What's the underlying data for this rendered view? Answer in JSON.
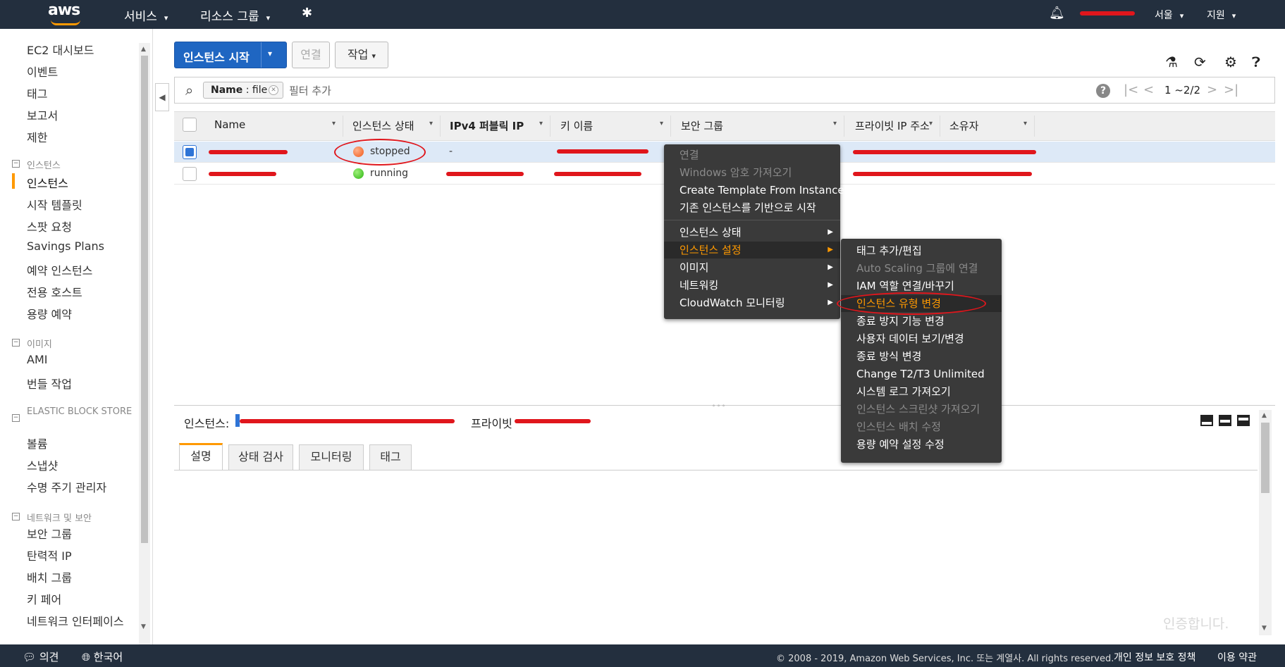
{
  "topbar": {
    "logo_text": "aws",
    "services": "서비스",
    "resource_groups": "리소스 그룹",
    "pin_icon": "pin-icon",
    "bell_icon": "bell-icon",
    "region": "서울",
    "support": "지원",
    "caret": "▾"
  },
  "sidebar": {
    "top_items": [
      "EC2 대시보드",
      "이벤트",
      "태그",
      "보고서",
      "제한"
    ],
    "sections": [
      {
        "title": "인스턴스",
        "items": [
          "인스턴스",
          "시작 템플릿",
          "스팟 요청",
          "Savings Plans",
          "예약 인스턴스",
          "전용 호스트",
          "용량 예약"
        ]
      },
      {
        "title": "이미지",
        "items": [
          "AMI",
          "번들 작업"
        ]
      },
      {
        "title": "ELASTIC BLOCK STORE",
        "items": [
          "볼륨",
          "스냅샷",
          "수명 주기 관리자"
        ]
      },
      {
        "title": "네트워크 및 보안",
        "items": [
          "보안 그룹",
          "탄력적 IP",
          "배치 그룹",
          "키 페어",
          "네트워크 인터페이스"
        ]
      }
    ],
    "active_item": "인스턴스"
  },
  "toolbar": {
    "launch": "인스턴스 시작",
    "connect": "연결",
    "actions": "작업"
  },
  "filter": {
    "chip_key": "Name",
    "chip_value": ": file",
    "placeholder": "필터 추가",
    "pagination": "1 ~2/2"
  },
  "table": {
    "columns": [
      "Name",
      "인스턴스 상태",
      "IPv4 퍼블릭 IP",
      "키 이름",
      "보안 그룹",
      "프라이빗 IP 주소",
      "소유자"
    ],
    "rows": [
      {
        "status": "stopped",
        "ipv4": "-",
        "selected": true
      },
      {
        "status": "running",
        "ipv4": "",
        "selected": false
      }
    ]
  },
  "detail": {
    "instance_label": "인스턴스:",
    "private_label": "프라이빗",
    "tabs": [
      "설명",
      "상태 검사",
      "모니터링",
      "태그"
    ]
  },
  "context_menu": {
    "group1": [
      {
        "label": "연결",
        "disabled": true
      },
      {
        "label": "Windows 암호 가져오기",
        "disabled": true
      },
      {
        "label": "Create Template From Instance",
        "disabled": false
      },
      {
        "label": "기존 인스턴스를 기반으로 시작",
        "disabled": false
      }
    ],
    "group2": [
      {
        "label": "인스턴스 상태",
        "highlight": false
      },
      {
        "label": "인스턴스 설정",
        "highlight": true
      },
      {
        "label": "이미지",
        "highlight": false
      },
      {
        "label": "네트워킹",
        "highlight": false
      },
      {
        "label": "CloudWatch 모니터링",
        "highlight": false
      }
    ]
  },
  "submenu": [
    {
      "label": "태그 추가/편집",
      "disabled": false
    },
    {
      "label": "Auto Scaling 그룹에 연결",
      "disabled": true
    },
    {
      "label": "IAM 역할 연결/바꾸기",
      "disabled": false
    },
    {
      "label": "인스턴스 유형 변경",
      "disabled": false,
      "highlight": true
    },
    {
      "label": "종료 방지 기능 변경",
      "disabled": false
    },
    {
      "label": "사용자 데이터 보기/변경",
      "disabled": false
    },
    {
      "label": "종료 방식 변경",
      "disabled": false
    },
    {
      "label": "Change T2/T3 Unlimited",
      "disabled": false
    },
    {
      "label": "시스템 로그 가져오기",
      "disabled": false
    },
    {
      "label": "인스턴스 스크린샷 가져오기",
      "disabled": true
    },
    {
      "label": "인스턴스 배치 수정",
      "disabled": true
    },
    {
      "label": "용량 예약 설정 수정",
      "disabled": false
    }
  ],
  "watermark": "인증합니다.",
  "footer": {
    "feedback": "의견",
    "language": "한국어",
    "copyright": "© 2008 - 2019, Amazon Web Services, Inc. 또는 계열사. All rights reserved.",
    "privacy": "개인 정보 보호 정책",
    "terms": "이용 약관"
  },
  "colors": {
    "topbar": "#232f3e",
    "accent_orange": "#ff9900",
    "primary_blue": "#1f66c2",
    "annotation_red": "#e0161c"
  }
}
